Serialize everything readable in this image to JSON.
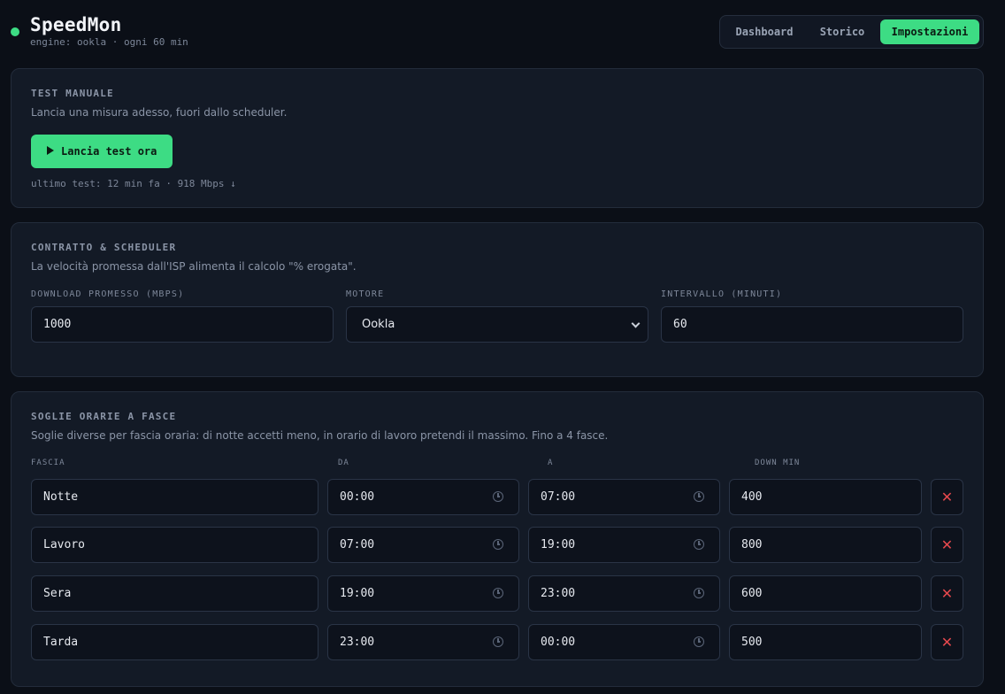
{
  "header": {
    "title": "SpeedMon",
    "subtitle": "engine: ookla · ogni 60 min",
    "status_color": "#3ddc84",
    "nav": [
      {
        "label": "Dashboard",
        "active": false
      },
      {
        "label": "Storico",
        "active": false
      },
      {
        "label": "Impostazioni",
        "active": true
      }
    ]
  },
  "manual_test": {
    "title": "TEST MANUALE",
    "description": "Lancia una misura adesso, fuori dallo scheduler.",
    "button_label": "Lancia test ora",
    "button_icon": "play-icon",
    "last_test": "ultimo test: 12 min fa · 918 Mbps ↓"
  },
  "contract": {
    "title": "CONTRATTO & SCHEDULER",
    "description": "La velocità promessa dall'ISP alimenta il calcolo \"% erogata\".",
    "download_label": "DOWNLOAD PROMESSO (MBPS)",
    "download_value": "1000",
    "engine_label": "MOTORE",
    "engine_value": "Ookla",
    "interval_label": "INTERVALLO (MINUTI)",
    "interval_value": "60"
  },
  "thresholds": {
    "title": "SOGLIE ORARIE A FASCE",
    "description": "Soglie diverse per fascia oraria: di notte accetti meno, in orario di lavoro pretendi il massimo. Fino a 4 fasce.",
    "columns": {
      "name": "FASCIA",
      "from": "DA",
      "to": "A",
      "min": "DOWN MIN"
    },
    "rows": [
      {
        "name": "Notte",
        "from": "00:00",
        "to": "07:00",
        "min": "400"
      },
      {
        "name": "Lavoro",
        "from": "07:00",
        "to": "19:00",
        "min": "800"
      },
      {
        "name": "Sera",
        "from": "19:00",
        "to": "23:00",
        "min": "600"
      },
      {
        "name": "Tarda",
        "from": "23:00",
        "to": "00:00",
        "min": "500"
      }
    ],
    "delete_icon": "close-icon",
    "time_icon": "clock-icon",
    "delete_color": "#e5484d"
  }
}
